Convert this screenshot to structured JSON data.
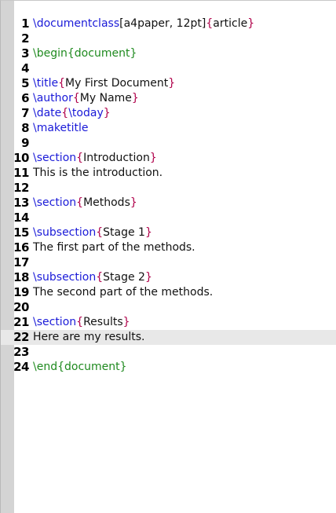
{
  "editor": {
    "current_line": 22,
    "lines": [
      {
        "n": "1",
        "tokens": [
          {
            "t": "\\documentclass",
            "c": "cmd"
          },
          {
            "t": "[",
            "c": "sep"
          },
          {
            "t": "a4paper, 12pt",
            "c": "argname"
          },
          {
            "t": "]",
            "c": "sep"
          },
          {
            "t": "{",
            "c": "brace"
          },
          {
            "t": "article",
            "c": "argname"
          },
          {
            "t": "}",
            "c": "brace"
          }
        ]
      },
      {
        "n": "2",
        "tokens": []
      },
      {
        "n": "3",
        "tokens": [
          {
            "t": "\\begin",
            "c": "env"
          },
          {
            "t": "{",
            "c": "env"
          },
          {
            "t": "document",
            "c": "env"
          },
          {
            "t": "}",
            "c": "env"
          }
        ]
      },
      {
        "n": "4",
        "tokens": []
      },
      {
        "n": "5",
        "tokens": [
          {
            "t": "\\title",
            "c": "cmd"
          },
          {
            "t": "{",
            "c": "brace"
          },
          {
            "t": "My First Document",
            "c": "argname"
          },
          {
            "t": "}",
            "c": "brace"
          }
        ]
      },
      {
        "n": "6",
        "tokens": [
          {
            "t": "\\author",
            "c": "cmd"
          },
          {
            "t": "{",
            "c": "brace"
          },
          {
            "t": "My Name",
            "c": "argname"
          },
          {
            "t": "}",
            "c": "brace"
          }
        ]
      },
      {
        "n": "7",
        "tokens": [
          {
            "t": "\\date",
            "c": "cmd"
          },
          {
            "t": "{",
            "c": "brace"
          },
          {
            "t": "\\today",
            "c": "cmd"
          },
          {
            "t": "}",
            "c": "brace"
          }
        ]
      },
      {
        "n": "8",
        "tokens": [
          {
            "t": "\\maketitle",
            "c": "cmd"
          }
        ]
      },
      {
        "n": "9",
        "tokens": []
      },
      {
        "n": "10",
        "tokens": [
          {
            "t": "\\section",
            "c": "cmd"
          },
          {
            "t": "{",
            "c": "brace"
          },
          {
            "t": "Introduction",
            "c": "argname"
          },
          {
            "t": "}",
            "c": "brace"
          }
        ]
      },
      {
        "n": "11",
        "tokens": [
          {
            "t": "This is the introduction.",
            "c": "plain"
          }
        ]
      },
      {
        "n": "12",
        "tokens": []
      },
      {
        "n": "13",
        "tokens": [
          {
            "t": "\\section",
            "c": "cmd"
          },
          {
            "t": "{",
            "c": "brace"
          },
          {
            "t": "Methods",
            "c": "argname"
          },
          {
            "t": "}",
            "c": "brace"
          }
        ]
      },
      {
        "n": "14",
        "tokens": []
      },
      {
        "n": "15",
        "tokens": [
          {
            "t": "\\subsection",
            "c": "cmd"
          },
          {
            "t": "{",
            "c": "brace"
          },
          {
            "t": "Stage 1",
            "c": "argname"
          },
          {
            "t": "}",
            "c": "brace"
          }
        ]
      },
      {
        "n": "16",
        "tokens": [
          {
            "t": "The first part of the methods.",
            "c": "plain"
          }
        ]
      },
      {
        "n": "17",
        "tokens": []
      },
      {
        "n": "18",
        "tokens": [
          {
            "t": "\\subsection",
            "c": "cmd"
          },
          {
            "t": "{",
            "c": "brace"
          },
          {
            "t": "Stage 2",
            "c": "argname"
          },
          {
            "t": "}",
            "c": "brace"
          }
        ]
      },
      {
        "n": "19",
        "tokens": [
          {
            "t": "The second part of the methods.",
            "c": "plain"
          }
        ]
      },
      {
        "n": "20",
        "tokens": []
      },
      {
        "n": "21",
        "tokens": [
          {
            "t": "\\section",
            "c": "cmd"
          },
          {
            "t": "{",
            "c": "brace"
          },
          {
            "t": "Results",
            "c": "argname"
          },
          {
            "t": "}",
            "c": "brace"
          }
        ]
      },
      {
        "n": "22",
        "tokens": [
          {
            "t": "Here are my results.",
            "c": "plain"
          }
        ]
      },
      {
        "n": "23",
        "tokens": []
      },
      {
        "n": "24",
        "tokens": [
          {
            "t": "\\end",
            "c": "env"
          },
          {
            "t": "{",
            "c": "env"
          },
          {
            "t": "document",
            "c": "env"
          },
          {
            "t": "}",
            "c": "env"
          }
        ]
      }
    ]
  },
  "colors": {
    "command": "#1a1ad8",
    "environment": "#1f8a1f",
    "brace": "#b0004a",
    "text": "#111111",
    "gutter": "#d4d4d4",
    "current_line_bg": "#e8e8e8"
  }
}
